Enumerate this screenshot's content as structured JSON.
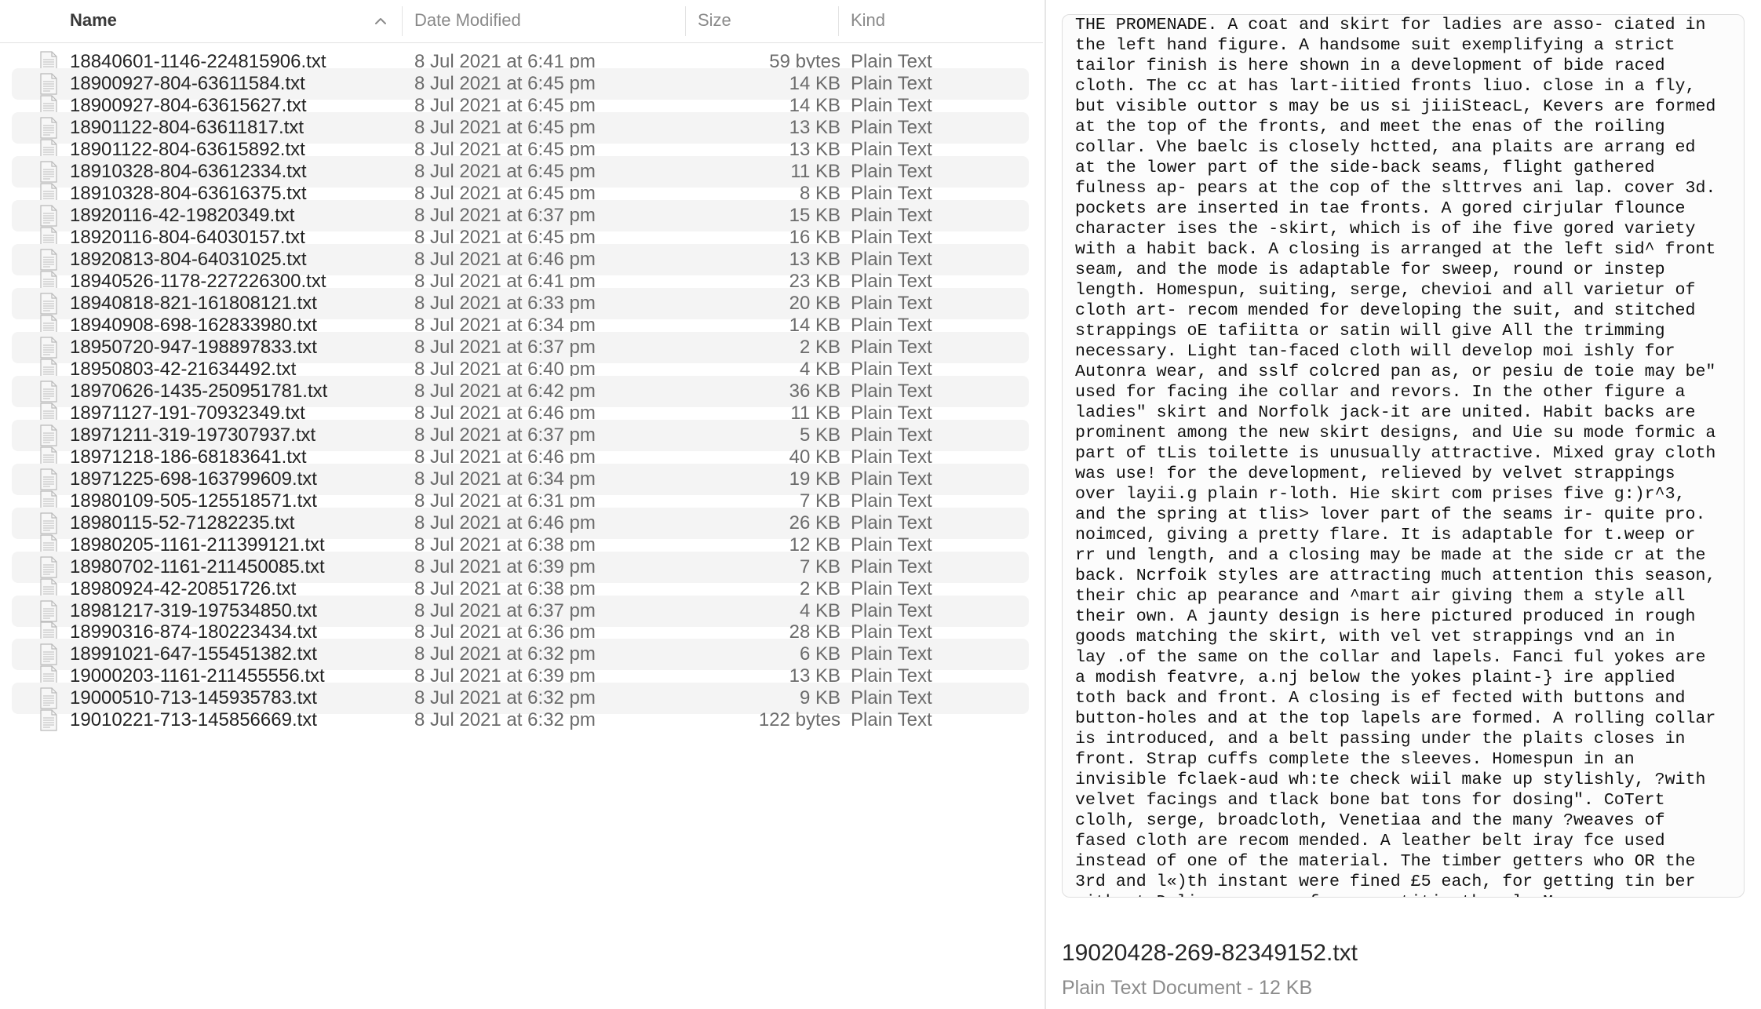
{
  "columns": {
    "name": "Name",
    "date_modified": "Date Modified",
    "size": "Size",
    "kind": "Kind",
    "sort_direction": "ascending"
  },
  "files": [
    {
      "name": "18840601-1146-224815906.txt",
      "date": "8 Jul 2021 at 6:41 pm",
      "size": "59 bytes",
      "kind": "Plain Text"
    },
    {
      "name": "18900927-804-63611584.txt",
      "date": "8 Jul 2021 at 6:45 pm",
      "size": "14 KB",
      "kind": "Plain Text"
    },
    {
      "name": "18900927-804-63615627.txt",
      "date": "8 Jul 2021 at 6:45 pm",
      "size": "14 KB",
      "kind": "Plain Text"
    },
    {
      "name": "18901122-804-63611817.txt",
      "date": "8 Jul 2021 at 6:45 pm",
      "size": "13 KB",
      "kind": "Plain Text"
    },
    {
      "name": "18901122-804-63615892.txt",
      "date": "8 Jul 2021 at 6:45 pm",
      "size": "13 KB",
      "kind": "Plain Text"
    },
    {
      "name": "18910328-804-63612334.txt",
      "date": "8 Jul 2021 at 6:45 pm",
      "size": "11 KB",
      "kind": "Plain Text"
    },
    {
      "name": "18910328-804-63616375.txt",
      "date": "8 Jul 2021 at 6:45 pm",
      "size": "8 KB",
      "kind": "Plain Text"
    },
    {
      "name": "18920116-42-19820349.txt",
      "date": "8 Jul 2021 at 6:37 pm",
      "size": "15 KB",
      "kind": "Plain Text"
    },
    {
      "name": "18920116-804-64030157.txt",
      "date": "8 Jul 2021 at 6:45 pm",
      "size": "16 KB",
      "kind": "Plain Text"
    },
    {
      "name": "18920813-804-64031025.txt",
      "date": "8 Jul 2021 at 6:46 pm",
      "size": "13 KB",
      "kind": "Plain Text"
    },
    {
      "name": "18940526-1178-227226300.txt",
      "date": "8 Jul 2021 at 6:41 pm",
      "size": "23 KB",
      "kind": "Plain Text"
    },
    {
      "name": "18940818-821-161808121.txt",
      "date": "8 Jul 2021 at 6:33 pm",
      "size": "20 KB",
      "kind": "Plain Text"
    },
    {
      "name": "18940908-698-162833980.txt",
      "date": "8 Jul 2021 at 6:34 pm",
      "size": "14 KB",
      "kind": "Plain Text"
    },
    {
      "name": "18950720-947-198897833.txt",
      "date": "8 Jul 2021 at 6:37 pm",
      "size": "2 KB",
      "kind": "Plain Text"
    },
    {
      "name": "18950803-42-21634492.txt",
      "date": "8 Jul 2021 at 6:40 pm",
      "size": "4 KB",
      "kind": "Plain Text"
    },
    {
      "name": "18970626-1435-250951781.txt",
      "date": "8 Jul 2021 at 6:42 pm",
      "size": "36 KB",
      "kind": "Plain Text"
    },
    {
      "name": "18971127-191-70932349.txt",
      "date": "8 Jul 2021 at 6:46 pm",
      "size": "11 KB",
      "kind": "Plain Text"
    },
    {
      "name": "18971211-319-197307937.txt",
      "date": "8 Jul 2021 at 6:37 pm",
      "size": "5 KB",
      "kind": "Plain Text"
    },
    {
      "name": "18971218-186-68183641.txt",
      "date": "8 Jul 2021 at 6:46 pm",
      "size": "40 KB",
      "kind": "Plain Text"
    },
    {
      "name": "18971225-698-163799609.txt",
      "date": "8 Jul 2021 at 6:34 pm",
      "size": "19 KB",
      "kind": "Plain Text"
    },
    {
      "name": "18980109-505-125518571.txt",
      "date": "8 Jul 2021 at 6:31 pm",
      "size": "7 KB",
      "kind": "Plain Text"
    },
    {
      "name": "18980115-52-71282235.txt",
      "date": "8 Jul 2021 at 6:46 pm",
      "size": "26 KB",
      "kind": "Plain Text"
    },
    {
      "name": "18980205-1161-211399121.txt",
      "date": "8 Jul 2021 at 6:38 pm",
      "size": "12 KB",
      "kind": "Plain Text"
    },
    {
      "name": "18980702-1161-211450085.txt",
      "date": "8 Jul 2021 at 6:39 pm",
      "size": "7 KB",
      "kind": "Plain Text"
    },
    {
      "name": "18980924-42-20851726.txt",
      "date": "8 Jul 2021 at 6:38 pm",
      "size": "2 KB",
      "kind": "Plain Text"
    },
    {
      "name": "18981217-319-197534850.txt",
      "date": "8 Jul 2021 at 6:37 pm",
      "size": "4 KB",
      "kind": "Plain Text"
    },
    {
      "name": "18990316-874-180223434.txt",
      "date": "8 Jul 2021 at 6:36 pm",
      "size": "28 KB",
      "kind": "Plain Text"
    },
    {
      "name": "18991021-647-155451382.txt",
      "date": "8 Jul 2021 at 6:32 pm",
      "size": "6 KB",
      "kind": "Plain Text"
    },
    {
      "name": "19000203-1161-211455556.txt",
      "date": "8 Jul 2021 at 6:39 pm",
      "size": "13 KB",
      "kind": "Plain Text"
    },
    {
      "name": "19000510-713-145935783.txt",
      "date": "8 Jul 2021 at 6:32 pm",
      "size": "9 KB",
      "kind": "Plain Text"
    },
    {
      "name": "19010221-713-145856669.txt",
      "date": "8 Jul 2021 at 6:32 pm",
      "size": "122 bytes",
      "kind": "Plain Text"
    }
  ],
  "preview": {
    "text_lines": [
      "THE PROMENADE. A coat and skirt for ladies are asso- ciated in",
      "the left hand figure. A handsome suit exemplifying a strict",
      "tailor finish is here shown in a development of bide raced",
      "cloth. The cc at has lart-iitied fronts liuo. close in a fly,",
      "but visible outtor s may be us si jiiiSteacL, Kevers are formed",
      "at the top of the fronts, and meet the enas of the roiling",
      "collar. Vhe baelc is closely hctted, ana plaits are arrang ed",
      "at the lower part of the side-back seams, flight gathered",
      "fulness ap- pears at the cop of the slttrves ani lap. cover 3d.",
      "pockets are inserted in tae fronts. A gored cirjular flounce",
      "character ises the -skirt, which is of ihe five gored variety",
      "with a habit back. A closing is arranged at the left sid^ front",
      "seam, and the mode is adaptable for sweep, round or instep",
      "length. Homespun, suiting, serge, chevioi and all varietur of",
      "cloth art- recom mended for developing the suit, and stitched",
      "strappings oE tafiitta or satin will give All the trimming",
      "necessary. Light tan-faced cloth will develop moi ishly for",
      "Autonra wear, and sslf colcred pan as, or pesiu de toie may be\"",
      "used for facing ihe collar and revors. In the other figure a",
      "ladies\" skirt and Norfolk jack-it are united. Habit backs are",
      "prominent among the new skirt designs, and Uie su mode formic a",
      "part of tLis toilette is unusually attractive. Mixed gray cloth",
      "was use! for the development, relieved by velvet strappings",
      "over layii.g plain r-loth. Hie skirt com prises five g:)r^3,",
      "and the spring at tlis> lover part of the seams ir- quite pro.",
      "noimced, giving a pretty flare. It is adaptable for t.weep or",
      "rr und length, and a closing may be made at the side cr at the",
      "back. Ncrfoik styles are attracting much attention this season,",
      "their chic ap pearance and ^mart air giving them a style all",
      "their own. A jaunty design is here pictured produced in rough",
      "goods matching the skirt, with vel vet strappings vnd an in",
      "lay .of the same on the collar and lapels. Fanci ful yokes are",
      "a modish featvre, a.nj below the yokes plaint-} ire applied",
      "toth back and front. A closing is ef fected with buttons and",
      "button-holes and at the top lapels are formed. A rolling collar",
      "is introduced, and a belt passing under the plaits closes in",
      "front. Strap cuffs complete the sleeves. Homespun in an",
      "invisible fclaek-aud wh:te check wiil make up stylishly, ?with",
      "velvet facings and tlack bone bat tons for dosing\". CoTert",
      "clolh, serge, broadcloth, Venetiaa and the many ?weaves of",
      "fased cloth are recom mended. A leather belt iray fce used",
      "instead of one of the material. The timber getters who OR the",
      "3rd and l«)th instant were fined £5 each, for getting tin ber",
      "without Dolice.....co of........titim the cla.M......"
    ],
    "filename": "19020428-269-82349152.txt",
    "subtitle": "Plain Text Document - 12 KB"
  },
  "colors": {
    "row_stripe": "#f4f4f4",
    "header_text": "#8a8a8a",
    "secondary_text": "#6b6b6b",
    "primary_text": "#242424"
  },
  "icons": {
    "file": "text-document-icon",
    "sort": "chevron-up-icon"
  }
}
